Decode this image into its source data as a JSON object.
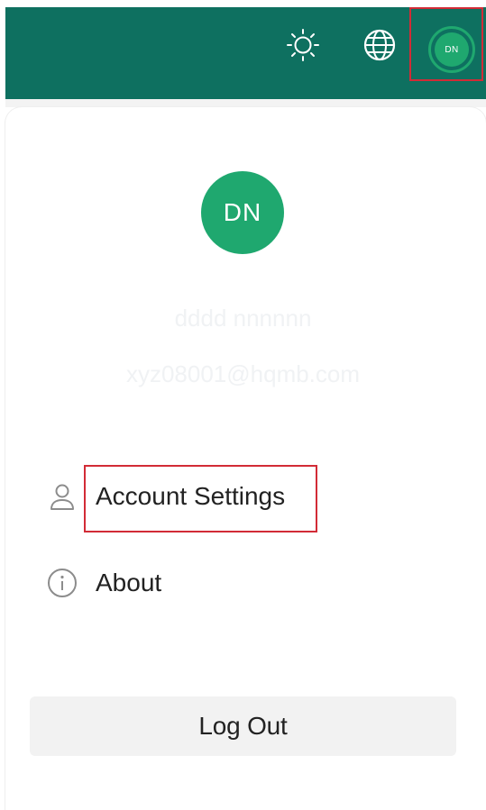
{
  "topbar": {
    "icons": [
      "sun-icon",
      "globe-icon"
    ],
    "avatar_initials": "DN"
  },
  "profile": {
    "avatar_initials": "DN",
    "name": "dddd nnnnnn",
    "email": "xyz08001@hqmb.com"
  },
  "menu": {
    "items": [
      {
        "label": "Account Settings",
        "icon": "person-icon"
      },
      {
        "label": "About",
        "icon": "info-icon"
      }
    ]
  },
  "actions": {
    "logout_label": "Log Out"
  },
  "colors": {
    "topbar_bg": "#0e7060",
    "avatar_green": "#1fa86f",
    "highlight_red": "#d22b36"
  }
}
